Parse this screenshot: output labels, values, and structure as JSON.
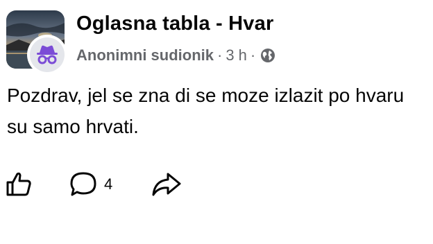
{
  "group": {
    "name": "Oglasna tabla - Hvar"
  },
  "meta": {
    "author": "Anonimni sudionik",
    "separator1": "·",
    "time": "3 h",
    "separator2": "·",
    "privacy_icon": "globe-icon"
  },
  "post": {
    "lines": [
      "Pozdrav, jel se zna di se moze izlazit po hvaru",
      "su samo hrvati."
    ]
  },
  "actions": {
    "like_icon": "thumbs-up-icon",
    "comment_icon": "comment-bubble-icon",
    "comment_count": "4",
    "share_icon": "share-arrow-icon"
  },
  "colors": {
    "text_primary": "#050505",
    "text_secondary": "#65676b",
    "anon_bg": "#e4e6eb",
    "anon_icon": "#7b4cd6"
  }
}
